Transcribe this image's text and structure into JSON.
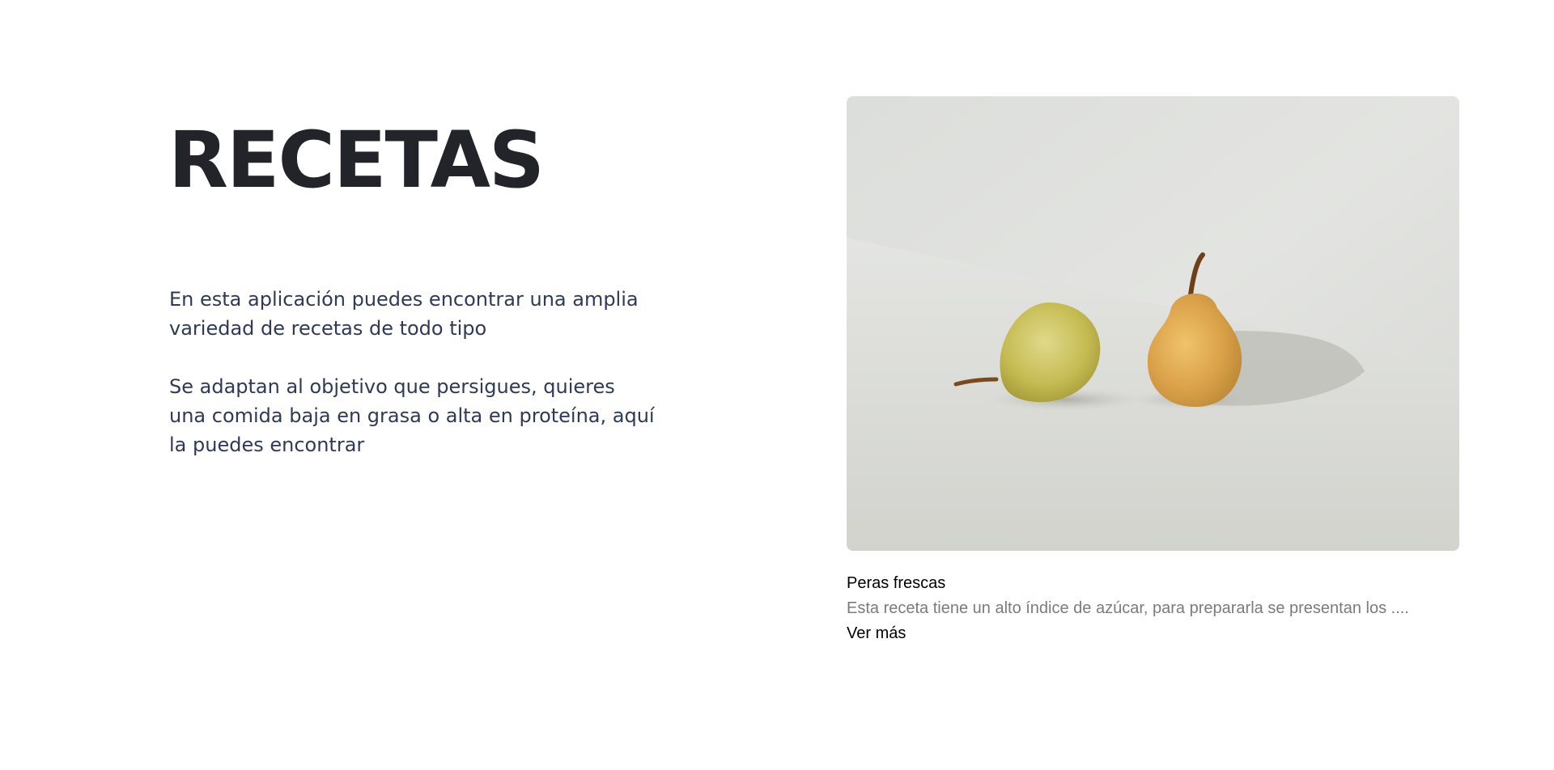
{
  "hero": {
    "title": "RECETAS",
    "paragraphs": [
      "En esta aplicación puedes encontrar una amplia variedad de recetas de todo tipo",
      "Se adaptan al objetivo que persigues, quieres una comida baja en grasa o alta en proteína, aquí la puedes encontrar"
    ]
  },
  "card": {
    "image_icon": "pears-photo",
    "title": "Peras frescas",
    "description": "Esta receta tiene un alto índice de azúcar, para prepararla se presentan los ....",
    "link_label": "Ver más"
  },
  "colors": {
    "heading": "#23242a",
    "body_text": "#2f3a56",
    "muted_text": "#7b7b7b"
  }
}
